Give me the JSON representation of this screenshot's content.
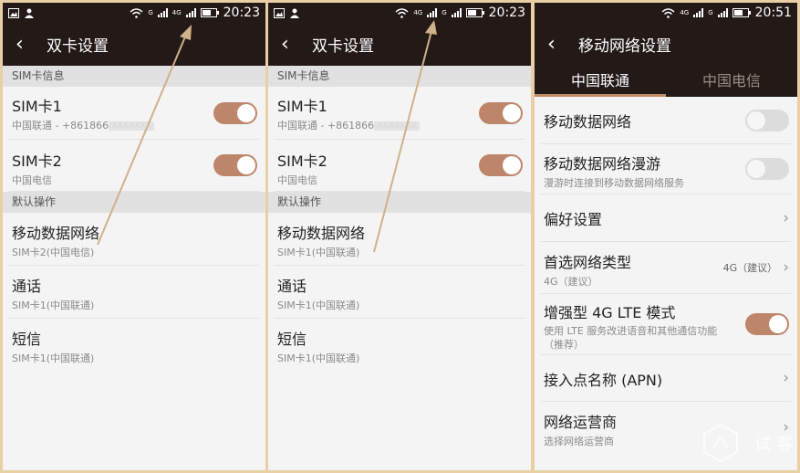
{
  "panel1": {
    "status": {
      "time": "20:23",
      "signal1": "G",
      "signal2": "4G"
    },
    "title": "双卡设置",
    "sim_section": "SIM卡信息",
    "sim1": {
      "name": "SIM卡1",
      "detail": "中国联通 - +861866",
      "masked": "XXXXXXX"
    },
    "sim2": {
      "name": "SIM卡2",
      "detail": "中国电信"
    },
    "default_section": "默认操作",
    "data": {
      "name": "移动数据网络",
      "value": "SIM卡2(中国电信)"
    },
    "call": {
      "name": "通话",
      "value": "SIM卡1(中国联通)"
    },
    "sms": {
      "name": "短信",
      "value": "SIM卡1(中国联通)"
    }
  },
  "panel2": {
    "status": {
      "time": "20:23",
      "signal1": "4G",
      "signal2": "G"
    },
    "title": "双卡设置",
    "sim_section": "SIM卡信息",
    "sim1": {
      "name": "SIM卡1",
      "detail": "中国联通 - +861866",
      "masked": "XXXXXXX"
    },
    "sim2": {
      "name": "SIM卡2",
      "detail": "中国电信"
    },
    "default_section": "默认操作",
    "data": {
      "name": "移动数据网络",
      "value": "SIM卡1(中国联通)"
    },
    "call": {
      "name": "通话",
      "value": "SIM卡1(中国联通)"
    },
    "sms": {
      "name": "短信",
      "value": "SIM卡1(中国联通)"
    }
  },
  "panel3": {
    "status": {
      "time": "20:51",
      "signal1": "4G",
      "signal2": "G"
    },
    "title": "移动网络设置",
    "tabs": [
      "中国联通",
      "中国电信"
    ],
    "items": [
      {
        "title": "移动数据网络"
      },
      {
        "title": "移动数据网络漫游",
        "sub": "漫游时连接到移动数据网络服务"
      },
      {
        "title": "偏好设置"
      },
      {
        "title": "首选网络类型",
        "sub": "4G（建议）",
        "value": "4G（建议）"
      },
      {
        "title": "增强型 4G LTE 模式",
        "sub": "使用 LTE 服务改进语音和其他通信功能（推荐）"
      },
      {
        "title": "接入点名称 (APN)"
      },
      {
        "title": "网络运营商",
        "sub": "选择网络运营商"
      }
    ]
  },
  "watermark": {
    "text": "试 客"
  },
  "colors": {
    "bar": "#231a17",
    "accent": "#bd8569",
    "arrow": "#cfb18a",
    "frame": "#e9cfa6"
  },
  "icons": [
    "image-icon",
    "person-icon",
    "wifi-icon",
    "signal-icon",
    "battery-icon",
    "back-arrow-icon",
    "chevron-right-icon"
  ]
}
